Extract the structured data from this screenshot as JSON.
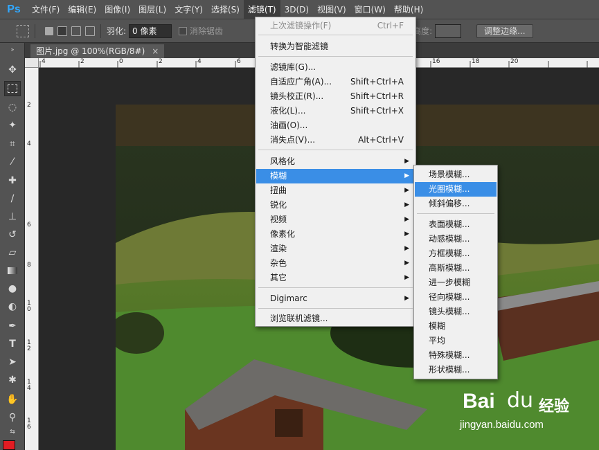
{
  "app_logo": "Ps",
  "menubar": {
    "items": [
      "文件(F)",
      "编辑(E)",
      "图像(I)",
      "图层(L)",
      "文字(Y)",
      "选择(S)",
      "滤镜(T)",
      "3D(D)",
      "视图(V)",
      "窗口(W)",
      "帮助(H)"
    ],
    "active_index": 6
  },
  "options": {
    "feather_label": "羽化:",
    "feather_value": "0 像素",
    "antialias_label": "消除锯齿",
    "height_label": "高度:",
    "refine_edge_label": "调整边缘..."
  },
  "document_tab": {
    "title": "图片.jpg @ 100%(RGB/8#)",
    "close": "×"
  },
  "ruler_top_labels": [
    "4",
    "2",
    "0",
    "2",
    "4",
    "6",
    "8",
    "10",
    "12",
    "14",
    "16",
    "18",
    "20"
  ],
  "ruler_left_labels": [
    "2",
    "4",
    "6",
    "8",
    "10",
    "12",
    "14",
    "16"
  ],
  "filter_menu": {
    "last_filter": "上次滤镜操作(F)",
    "last_filter_shortcut": "Ctrl+F",
    "smart_filter": "转换为智能滤镜",
    "gallery": "滤镜库(G)...",
    "adaptive_wide": "自适应广角(A)...",
    "adaptive_wide_shortcut": "Shift+Ctrl+A",
    "lens_correction": "镜头校正(R)...",
    "lens_correction_shortcut": "Shift+Ctrl+R",
    "liquify": "液化(L)...",
    "liquify_shortcut": "Shift+Ctrl+X",
    "oil_paint": "油画(O)...",
    "vanishing_point": "消失点(V)...",
    "vanishing_point_shortcut": "Alt+Ctrl+V",
    "stylize": "风格化",
    "blur": "模糊",
    "distort": "扭曲",
    "sharpen": "锐化",
    "video": "视频",
    "pixelate": "像素化",
    "render": "渲染",
    "noise": "杂色",
    "other": "其它",
    "digimarc": "Digimarc",
    "browse_online": "浏览联机滤镜..."
  },
  "blur_submenu": {
    "items": [
      "场景模糊...",
      "光圈模糊...",
      "倾斜偏移...",
      "表面模糊...",
      "动感模糊...",
      "方框模糊...",
      "高斯模糊...",
      "进一步模糊",
      "径向模糊...",
      "镜头模糊...",
      "模糊",
      "平均",
      "特殊模糊...",
      "形状模糊..."
    ],
    "highlighted_index": 1
  },
  "watermark": {
    "logo": "Bai",
    "paw": "du",
    "jingyan": "经验",
    "url": "jingyan.baidu.com"
  },
  "colors": {
    "foreground": "#e31c23",
    "menu_highlight": "#3a8ee6"
  }
}
